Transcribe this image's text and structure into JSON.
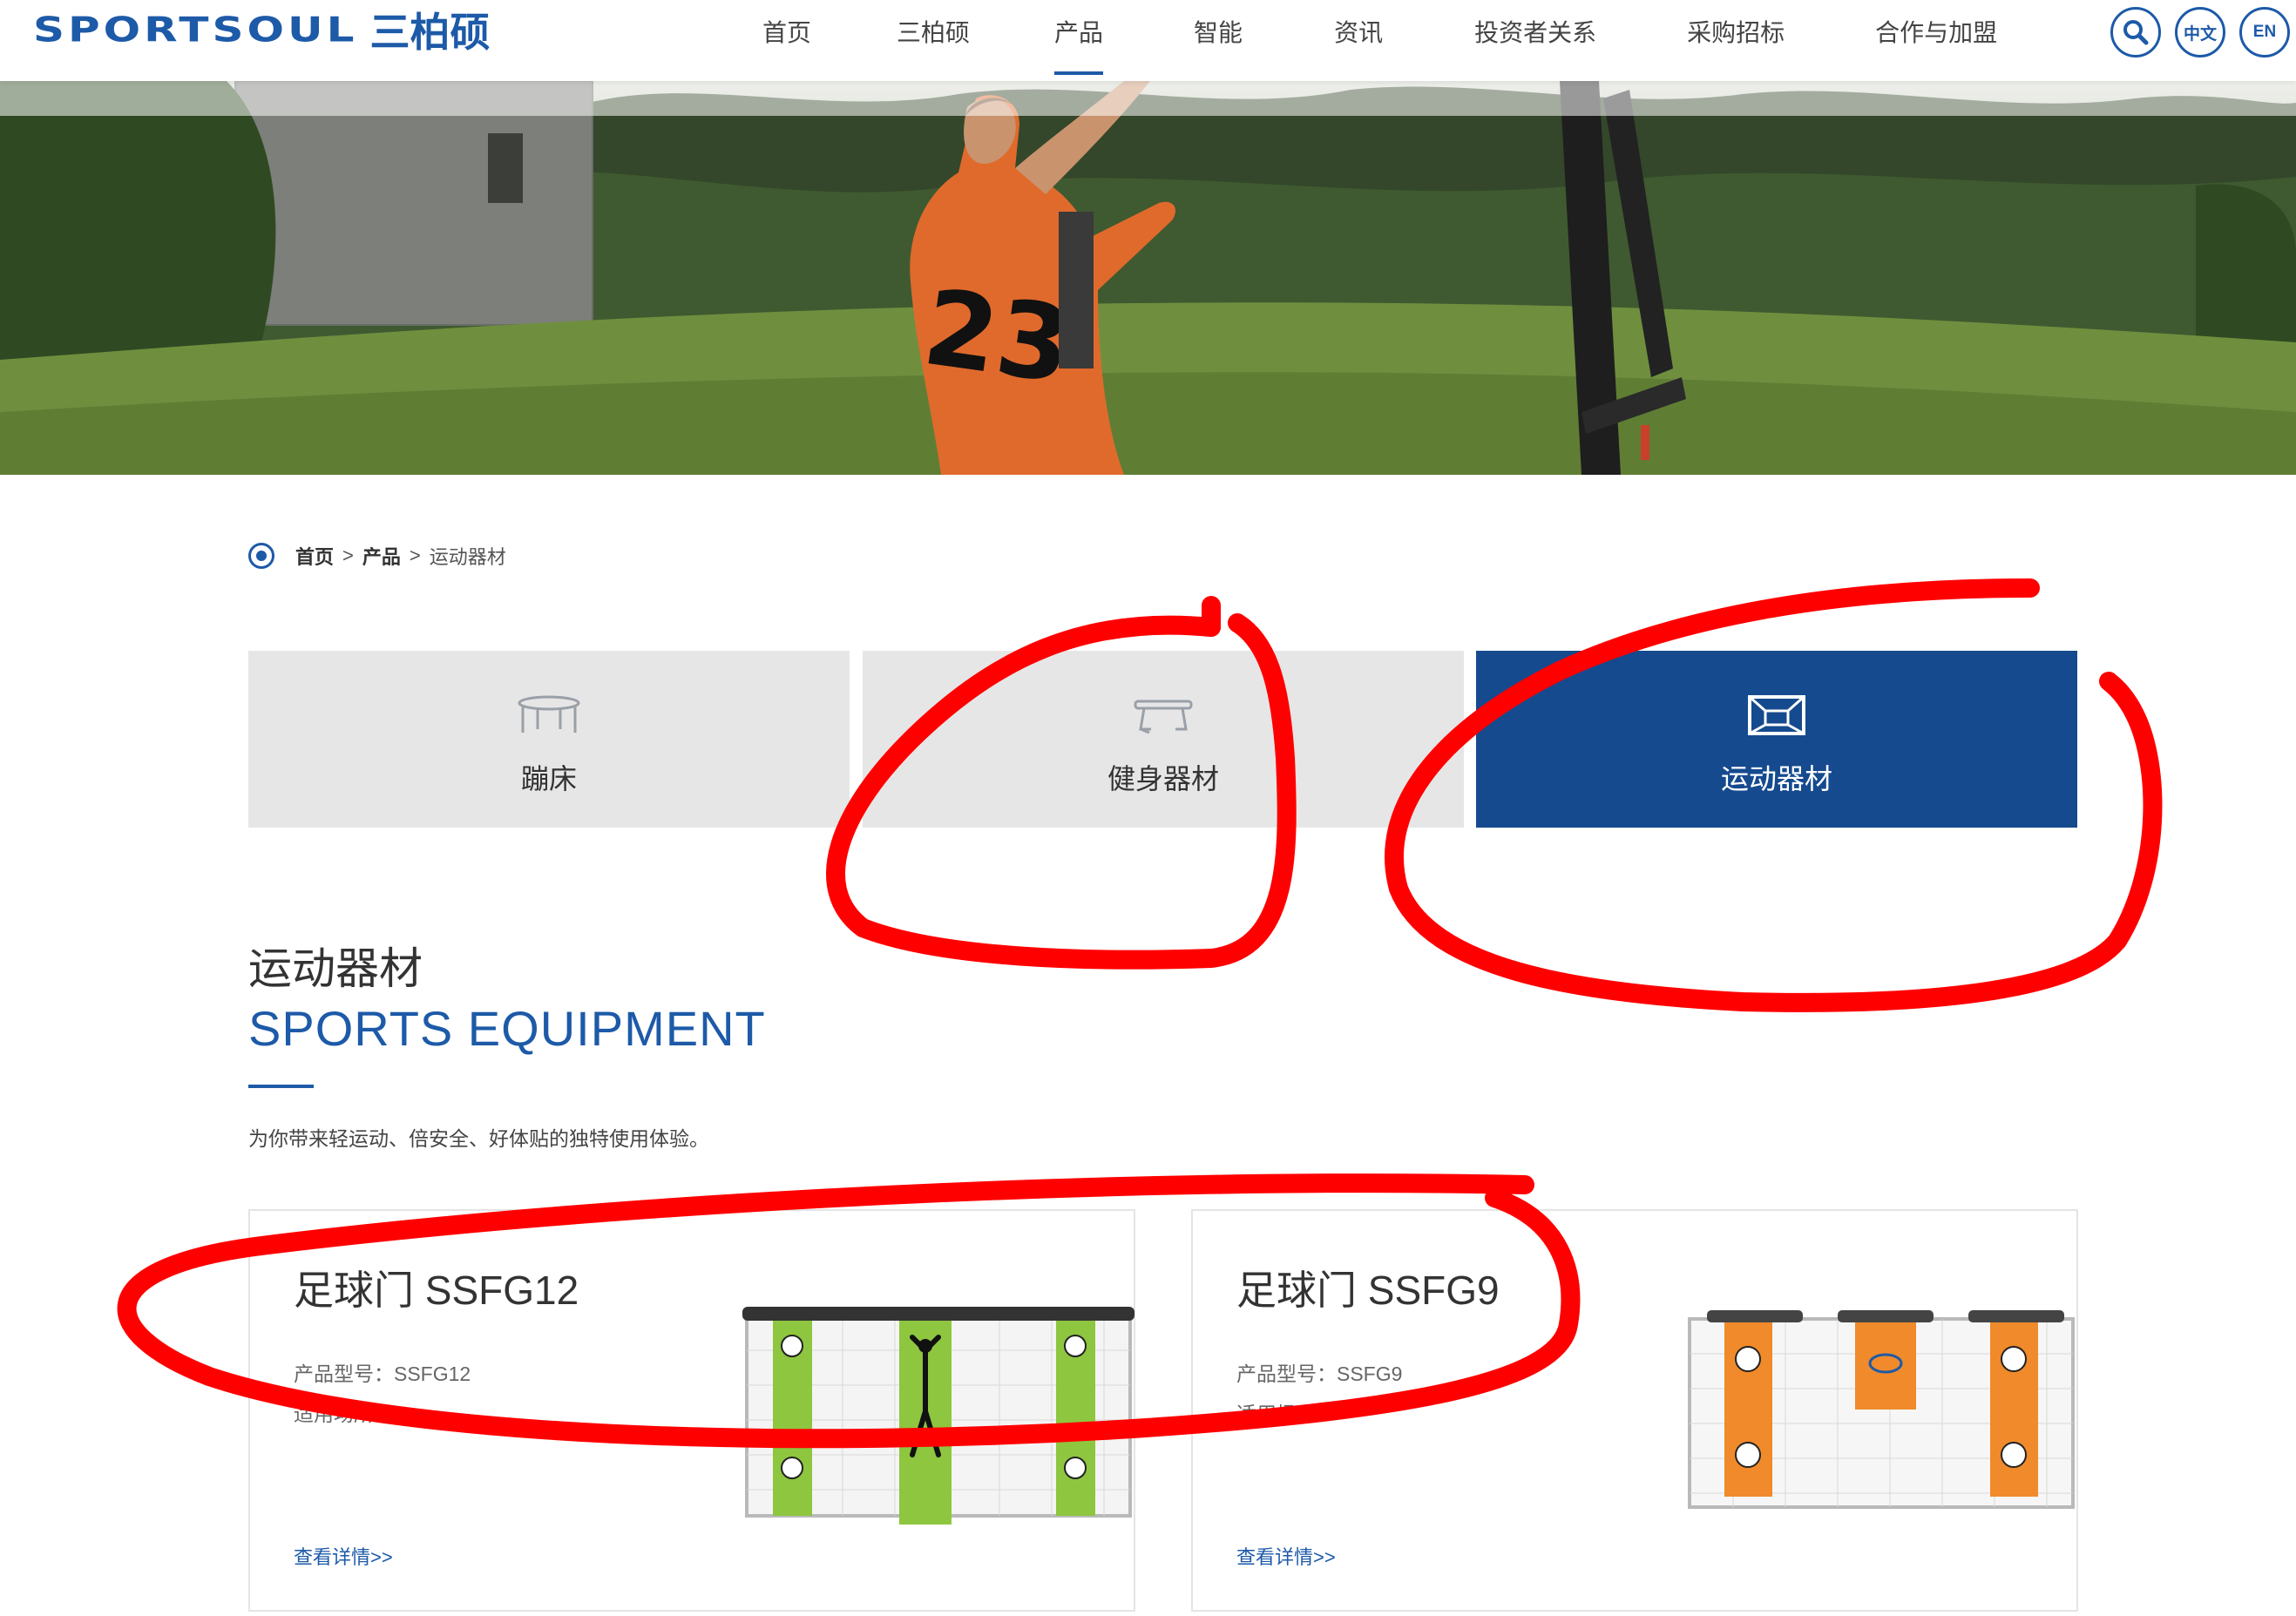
{
  "header": {
    "logo_en": "SPORTSOUL",
    "logo_cn": "三柏硕",
    "nav": [
      "首页",
      "三柏硕",
      "产品",
      "智能",
      "资讯",
      "投资者关系",
      "采购招标",
      "合作与加盟"
    ],
    "active_nav": "产品",
    "lang_cn": "中文",
    "lang_en": "EN",
    "search_icon": "search-icon",
    "brand_color": "#1d5aa8"
  },
  "breadcrumb": {
    "home": "首页",
    "sep1": ">",
    "products": "产品",
    "sep2": ">",
    "current": "运动器材"
  },
  "categories": [
    {
      "label": "蹦床",
      "icon": "trampoline-icon"
    },
    {
      "label": "健身器材",
      "icon": "bench-icon"
    },
    {
      "label": "运动器材",
      "icon": "goal-icon",
      "active": true
    }
  ],
  "active_tab_color": "#154a8e",
  "section": {
    "title_cn": "运动器材",
    "title_en": "SPORTS EQUIPMENT",
    "description": "为你带来轻运动、倍安全、好体贴的独特使用体验。"
  },
  "products": [
    {
      "title": "足球门 SSFG12",
      "model_label": "产品型号：",
      "model": "SSFG12",
      "venue_label": "适用场所：",
      "venue": "",
      "link": "查看详情>>"
    },
    {
      "title": "足球门 SSFG9",
      "model_label": "产品型号：",
      "model": "SSFG9",
      "venue_label": "适用场所：",
      "venue": "",
      "link": "查看详情>>"
    }
  ],
  "annotation_color": "#ff0000"
}
